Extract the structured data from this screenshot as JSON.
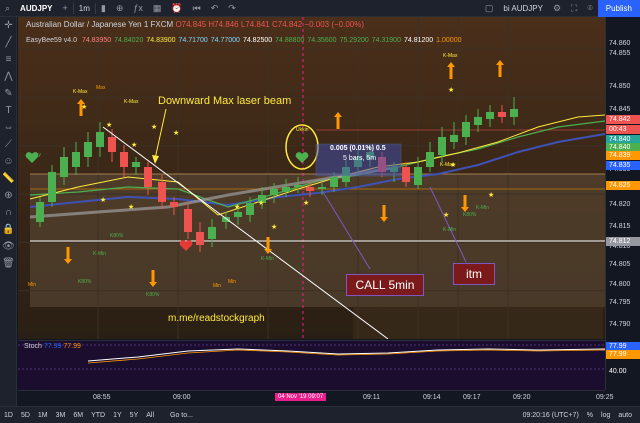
{
  "topbar": {
    "symbol": "AUDJPY",
    "interval": "1m",
    "right_user": "bi AUDJPY",
    "publish_label": "Publish"
  },
  "legend": {
    "title": "Australian Dollar / Japanese Yen  1  FXCM",
    "ohlc": "O74.845 H74.846 L74.841 C74.842 −0.003 (−0.00%)",
    "indicator_name": "EasyBee59 v4.0",
    "indicator_values": [
      {
        "text": "74.83950",
        "color": "#ff8080"
      },
      {
        "text": "74.84020",
        "color": "#4caf50"
      },
      {
        "text": "74.83900",
        "color": "#ffeb3b"
      },
      {
        "text": "74.71700",
        "color": "#80d8ff"
      },
      {
        "text": "74.77000",
        "color": "#80d8ff"
      },
      {
        "text": "74.82500",
        "color": "#ffffff"
      },
      {
        "text": "74.88800",
        "color": "#4caf50"
      },
      {
        "text": "74.35600",
        "color": "#4caf50"
      },
      {
        "text": "75.29200",
        "color": "#4caf50"
      },
      {
        "text": "74.31900",
        "color": "#4caf50"
      },
      {
        "text": "74.81200",
        "color": "#ffffff"
      },
      {
        "text": "1.00000",
        "color": "#ff9800"
      }
    ]
  },
  "annotations": {
    "downward": "Downward Max laser beam",
    "measure_line1": "0.005 (0.01%) 0.5",
    "measure_line2": "5 bars, 5m",
    "call": "CALL 5min",
    "itm": "itm",
    "url": "m.me/readstockgraph",
    "kmax": "K-Max",
    "kmin": "K-Min",
    "k80": "K80%",
    "min": "Min",
    "max": "Max",
    "lucky": "Lucky",
    "ukkin": "Ukkin"
  },
  "stoch": {
    "label": "Stoch",
    "k": "77.99",
    "d": "77.99"
  },
  "price_scale": {
    "ticks": [
      "74.860",
      "74.855",
      "74.850",
      "74.845",
      "74.830",
      "74.820",
      "74.815",
      "74.810",
      "74.805",
      "74.800",
      "74.795",
      "74.790"
    ],
    "tags": [
      {
        "text": "74.842",
        "color": "#ef5350"
      },
      {
        "text": "00:43",
        "color": "#ef5350"
      },
      {
        "text": "74.840",
        "color": "#26a69a"
      },
      {
        "text": "74.840",
        "color": "#4caf50"
      },
      {
        "text": "74.839",
        "color": "#ff9800"
      },
      {
        "text": "74.835",
        "color": "#2962ff"
      },
      {
        "text": "74.825",
        "color": "#ff9800"
      },
      {
        "text": "74.812",
        "color": "#9598a1"
      }
    ],
    "stoch_ticks": [
      "77.99",
      "77.99",
      "40.00"
    ]
  },
  "time_scale": {
    "ticks": [
      "08:55",
      "09:00",
      "09:11",
      "09:14",
      "09:17",
      "09:20",
      "09:25"
    ],
    "cursor": "04 Nov '19  09:07"
  },
  "bottombar": {
    "ranges": [
      "1D",
      "5D",
      "1M",
      "3M",
      "6M",
      "YTD",
      "1Y",
      "5Y",
      "All"
    ],
    "goto": "Go to...",
    "clock": "09:20:16 (UTC+7)",
    "pct": "%",
    "log": "log",
    "auto": "auto"
  },
  "colors": {
    "bull": "#4caf50",
    "bear": "#ef5350",
    "background": "#131722",
    "accent": "#2962ff"
  }
}
